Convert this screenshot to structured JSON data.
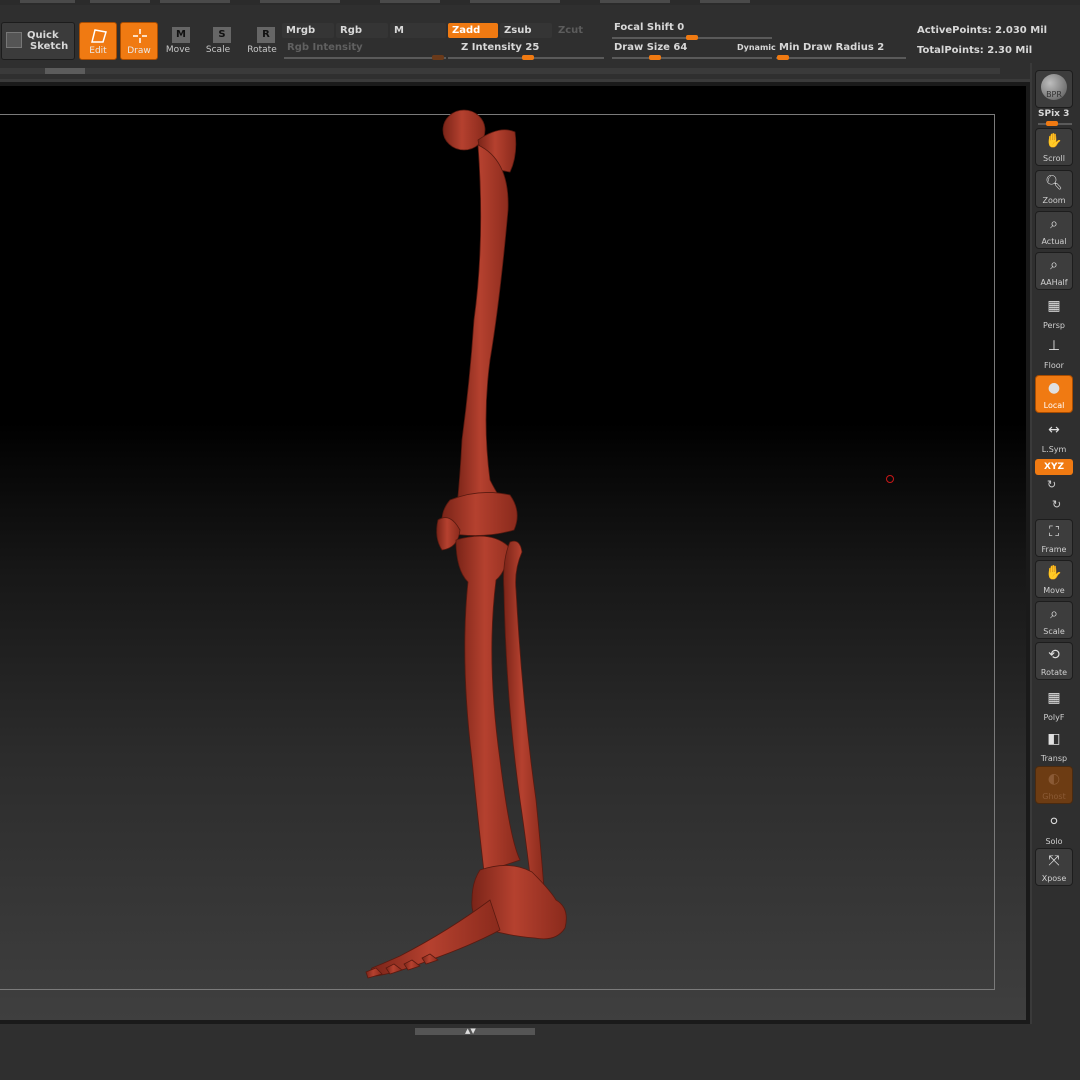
{
  "toolbar": {
    "quick_sketch": [
      "Quick",
      "Sketch"
    ],
    "edit": "Edit",
    "draw": "Draw",
    "move": "Move",
    "scale": "Scale",
    "rotate": "Rotate",
    "mrgb": "Mrgb",
    "rgb": "Rgb",
    "m": "M",
    "zadd": "Zadd",
    "zsub": "Zsub",
    "zcut": "Zcut",
    "rgb_intensity": "Rgb Intensity",
    "z_intensity": "Z Intensity 25",
    "focal_shift": "Focal Shift 0",
    "draw_size": "Draw Size 64",
    "dynamic": "Dynamic",
    "min_draw_radius": "Min Draw Radius 2",
    "active_points": "ActivePoints: 2.030 Mil",
    "total_points": "TotalPoints: 2.30 Mil",
    "z_intensity_value": 25,
    "focal_shift_value": 0,
    "draw_size_value": 64,
    "min_draw_radius_value": 2
  },
  "shelf": {
    "bpr": "BPR",
    "spix": "SPix 3",
    "spix_value": 3,
    "scroll": "Scroll",
    "zoom": "Zoom",
    "actual": "Actual",
    "aahalf": "AAHalf",
    "persp": "Persp",
    "floor": "Floor",
    "local": "Local",
    "lsym": "L.Sym",
    "xyz": "XYZ",
    "frame": "Frame",
    "move": "Move",
    "scale": "Scale",
    "rotate": "Rotate",
    "polyf": "PolyF",
    "transp": "Transp",
    "ghost": "Ghost",
    "solo": "Solo",
    "xpose": "Xpose"
  },
  "colors": {
    "accent": "#f07a12",
    "bone": "#b5412f",
    "panel": "#2f2f2f"
  }
}
